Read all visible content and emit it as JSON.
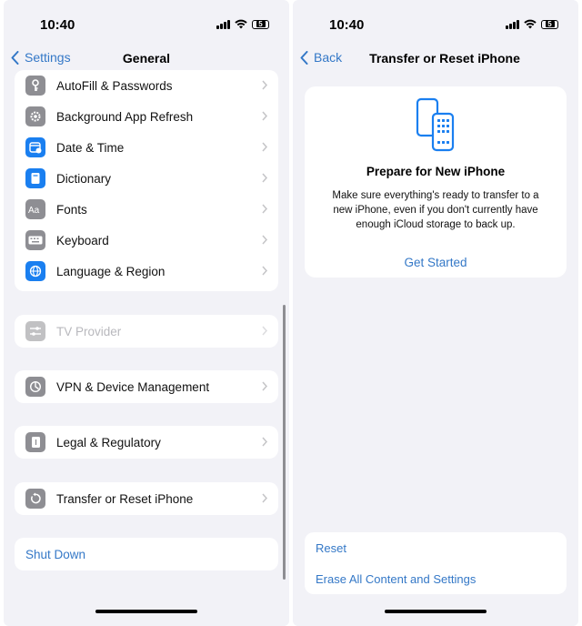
{
  "left": {
    "status": {
      "time": "10:40",
      "battery": "5"
    },
    "nav": {
      "back_label": "Settings",
      "title": "General"
    },
    "group1": [
      {
        "label": "AutoFill & Passwords",
        "icon": "key-icon",
        "color": "#8e8e93"
      },
      {
        "label": "Background App Refresh",
        "icon": "gear-icon",
        "color": "#8e8e93"
      },
      {
        "label": "Date & Time",
        "icon": "calendar-clock-icon",
        "color": "#1a7ff0"
      },
      {
        "label": "Dictionary",
        "icon": "book-icon",
        "color": "#1a7ff0"
      },
      {
        "label": "Fonts",
        "icon": "aa-icon",
        "color": "#8e8e93"
      },
      {
        "label": "Keyboard",
        "icon": "keyboard-icon",
        "color": "#8e8e93"
      },
      {
        "label": "Language & Region",
        "icon": "globe-icon",
        "color": "#1a7ff0"
      }
    ],
    "tv_provider": {
      "label": "TV Provider",
      "icon": "sliders-icon",
      "color": "#8e8e93"
    },
    "vpn": {
      "label": "VPN & Device Management",
      "icon": "gear-icon",
      "color": "#8e8e93"
    },
    "legal": {
      "label": "Legal & Regulatory",
      "icon": "document-icon",
      "color": "#8e8e93"
    },
    "transfer": {
      "label": "Transfer or Reset iPhone",
      "icon": "reset-icon",
      "color": "#8e8e93"
    },
    "shutdown": {
      "label": "Shut Down"
    }
  },
  "right": {
    "status": {
      "time": "10:40",
      "battery": "5"
    },
    "nav": {
      "back_label": "Back",
      "title": "Transfer or Reset iPhone"
    },
    "card": {
      "icon": "two-phones-icon",
      "title": "Prepare for New iPhone",
      "description": "Make sure everything's ready to transfer to a new iPhone, even if you don't currently have enough iCloud storage to back up.",
      "link": "Get Started"
    },
    "reset_label": "Reset",
    "erase_label": "Erase All Content and Settings"
  },
  "colors": {
    "accent": "#3478c7",
    "background": "#f2f2f7"
  }
}
